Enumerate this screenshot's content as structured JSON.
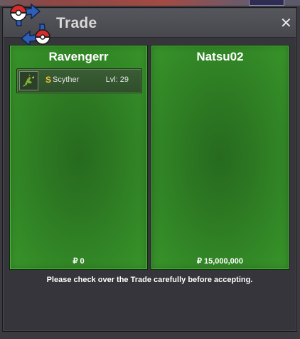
{
  "window": {
    "title": "Trade",
    "close_glyph": "✕",
    "logo_icon": "trade-swap-pokeball-icon",
    "notice": "Please check over the Trade carefully before accepting."
  },
  "panels": [
    {
      "player": "Ravengerr",
      "money_currency": "₽",
      "money": "0",
      "items": [
        {
          "shiny_badge": "S",
          "name": "Scyther",
          "level": "Lvl: 29",
          "icon": "scyther-sprite-icon"
        }
      ]
    },
    {
      "player": "Natsu02",
      "money_currency": "₽",
      "money": "15,000,000",
      "items": []
    }
  ],
  "colors": {
    "panel_green": "#2e7c23",
    "window_bg": "#35353b",
    "title_text": "#d8d8d8",
    "shiny_gold": "#f0c43c"
  }
}
